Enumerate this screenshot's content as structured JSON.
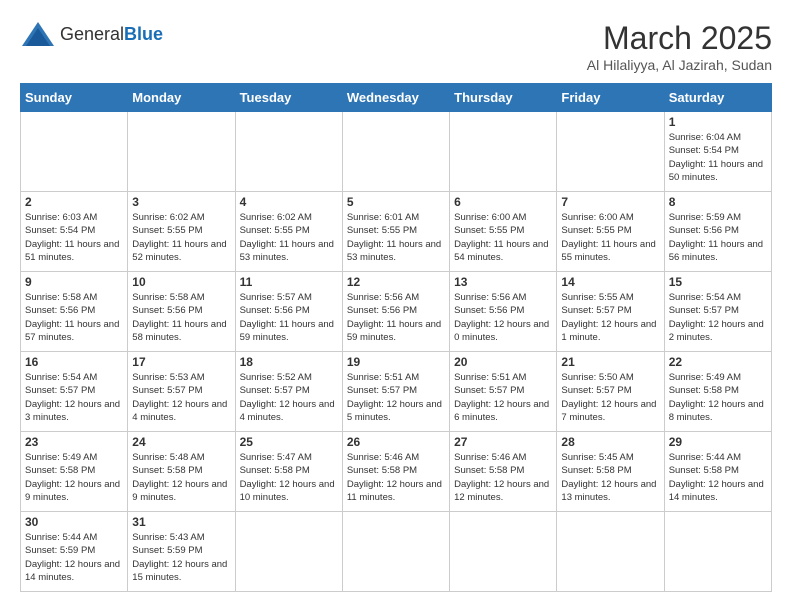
{
  "header": {
    "logo_general": "General",
    "logo_blue": "Blue",
    "title": "March 2025",
    "subtitle": "Al Hilaliyya, Al Jazirah, Sudan"
  },
  "weekdays": [
    "Sunday",
    "Monday",
    "Tuesday",
    "Wednesday",
    "Thursday",
    "Friday",
    "Saturday"
  ],
  "weeks": [
    [
      {
        "day": "",
        "info": ""
      },
      {
        "day": "",
        "info": ""
      },
      {
        "day": "",
        "info": ""
      },
      {
        "day": "",
        "info": ""
      },
      {
        "day": "",
        "info": ""
      },
      {
        "day": "",
        "info": ""
      },
      {
        "day": "1",
        "info": "Sunrise: 6:04 AM\nSunset: 5:54 PM\nDaylight: 11 hours and 50 minutes."
      }
    ],
    [
      {
        "day": "2",
        "info": "Sunrise: 6:03 AM\nSunset: 5:54 PM\nDaylight: 11 hours and 51 minutes."
      },
      {
        "day": "3",
        "info": "Sunrise: 6:02 AM\nSunset: 5:55 PM\nDaylight: 11 hours and 52 minutes."
      },
      {
        "day": "4",
        "info": "Sunrise: 6:02 AM\nSunset: 5:55 PM\nDaylight: 11 hours and 53 minutes."
      },
      {
        "day": "5",
        "info": "Sunrise: 6:01 AM\nSunset: 5:55 PM\nDaylight: 11 hours and 53 minutes."
      },
      {
        "day": "6",
        "info": "Sunrise: 6:00 AM\nSunset: 5:55 PM\nDaylight: 11 hours and 54 minutes."
      },
      {
        "day": "7",
        "info": "Sunrise: 6:00 AM\nSunset: 5:55 PM\nDaylight: 11 hours and 55 minutes."
      },
      {
        "day": "8",
        "info": "Sunrise: 5:59 AM\nSunset: 5:56 PM\nDaylight: 11 hours and 56 minutes."
      }
    ],
    [
      {
        "day": "9",
        "info": "Sunrise: 5:58 AM\nSunset: 5:56 PM\nDaylight: 11 hours and 57 minutes."
      },
      {
        "day": "10",
        "info": "Sunrise: 5:58 AM\nSunset: 5:56 PM\nDaylight: 11 hours and 58 minutes."
      },
      {
        "day": "11",
        "info": "Sunrise: 5:57 AM\nSunset: 5:56 PM\nDaylight: 11 hours and 59 minutes."
      },
      {
        "day": "12",
        "info": "Sunrise: 5:56 AM\nSunset: 5:56 PM\nDaylight: 11 hours and 59 minutes."
      },
      {
        "day": "13",
        "info": "Sunrise: 5:56 AM\nSunset: 5:56 PM\nDaylight: 12 hours and 0 minutes."
      },
      {
        "day": "14",
        "info": "Sunrise: 5:55 AM\nSunset: 5:57 PM\nDaylight: 12 hours and 1 minute."
      },
      {
        "day": "15",
        "info": "Sunrise: 5:54 AM\nSunset: 5:57 PM\nDaylight: 12 hours and 2 minutes."
      }
    ],
    [
      {
        "day": "16",
        "info": "Sunrise: 5:54 AM\nSunset: 5:57 PM\nDaylight: 12 hours and 3 minutes."
      },
      {
        "day": "17",
        "info": "Sunrise: 5:53 AM\nSunset: 5:57 PM\nDaylight: 12 hours and 4 minutes."
      },
      {
        "day": "18",
        "info": "Sunrise: 5:52 AM\nSunset: 5:57 PM\nDaylight: 12 hours and 4 minutes."
      },
      {
        "day": "19",
        "info": "Sunrise: 5:51 AM\nSunset: 5:57 PM\nDaylight: 12 hours and 5 minutes."
      },
      {
        "day": "20",
        "info": "Sunrise: 5:51 AM\nSunset: 5:57 PM\nDaylight: 12 hours and 6 minutes."
      },
      {
        "day": "21",
        "info": "Sunrise: 5:50 AM\nSunset: 5:57 PM\nDaylight: 12 hours and 7 minutes."
      },
      {
        "day": "22",
        "info": "Sunrise: 5:49 AM\nSunset: 5:58 PM\nDaylight: 12 hours and 8 minutes."
      }
    ],
    [
      {
        "day": "23",
        "info": "Sunrise: 5:49 AM\nSunset: 5:58 PM\nDaylight: 12 hours and 9 minutes."
      },
      {
        "day": "24",
        "info": "Sunrise: 5:48 AM\nSunset: 5:58 PM\nDaylight: 12 hours and 9 minutes."
      },
      {
        "day": "25",
        "info": "Sunrise: 5:47 AM\nSunset: 5:58 PM\nDaylight: 12 hours and 10 minutes."
      },
      {
        "day": "26",
        "info": "Sunrise: 5:46 AM\nSunset: 5:58 PM\nDaylight: 12 hours and 11 minutes."
      },
      {
        "day": "27",
        "info": "Sunrise: 5:46 AM\nSunset: 5:58 PM\nDaylight: 12 hours and 12 minutes."
      },
      {
        "day": "28",
        "info": "Sunrise: 5:45 AM\nSunset: 5:58 PM\nDaylight: 12 hours and 13 minutes."
      },
      {
        "day": "29",
        "info": "Sunrise: 5:44 AM\nSunset: 5:58 PM\nDaylight: 12 hours and 14 minutes."
      }
    ],
    [
      {
        "day": "30",
        "info": "Sunrise: 5:44 AM\nSunset: 5:59 PM\nDaylight: 12 hours and 14 minutes."
      },
      {
        "day": "31",
        "info": "Sunrise: 5:43 AM\nSunset: 5:59 PM\nDaylight: 12 hours and 15 minutes."
      },
      {
        "day": "",
        "info": ""
      },
      {
        "day": "",
        "info": ""
      },
      {
        "day": "",
        "info": ""
      },
      {
        "day": "",
        "info": ""
      },
      {
        "day": "",
        "info": ""
      }
    ]
  ]
}
